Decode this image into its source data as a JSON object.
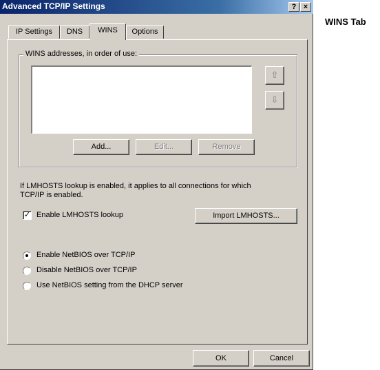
{
  "window": {
    "title": "Advanced TCP/IP Settings",
    "help_button": "?",
    "close_button": "×"
  },
  "tabs": [
    {
      "label": "IP Settings",
      "active": false
    },
    {
      "label": "DNS",
      "active": false
    },
    {
      "label": "WINS",
      "active": true
    },
    {
      "label": "Options",
      "active": false
    }
  ],
  "wins": {
    "group_label": "WINS addresses, in order of use:",
    "addresses": [],
    "move_up_icon": "arrow-up-icon",
    "move_down_icon": "arrow-down-icon",
    "add_label": "Add...",
    "edit_label": "Edit...",
    "remove_label": "Remove"
  },
  "lmhosts": {
    "description_line1": "If LMHOSTS lookup is enabled, it applies to all connections for which",
    "description_line2": "TCP/IP is enabled.",
    "enable_label": "Enable LMHOSTS lookup",
    "enable_checked": true,
    "check_mark": "✓",
    "import_label": "Import LMHOSTS..."
  },
  "netbios": {
    "options": [
      {
        "label": "Enable NetBIOS over TCP/IP",
        "selected": true
      },
      {
        "label": "Disable NetBIOS over TCP/IP",
        "selected": false
      },
      {
        "label": "Use NetBIOS setting from the DHCP server",
        "selected": false
      }
    ]
  },
  "footer": {
    "ok_label": "OK",
    "cancel_label": "Cancel"
  },
  "caption": "WINS Tab"
}
